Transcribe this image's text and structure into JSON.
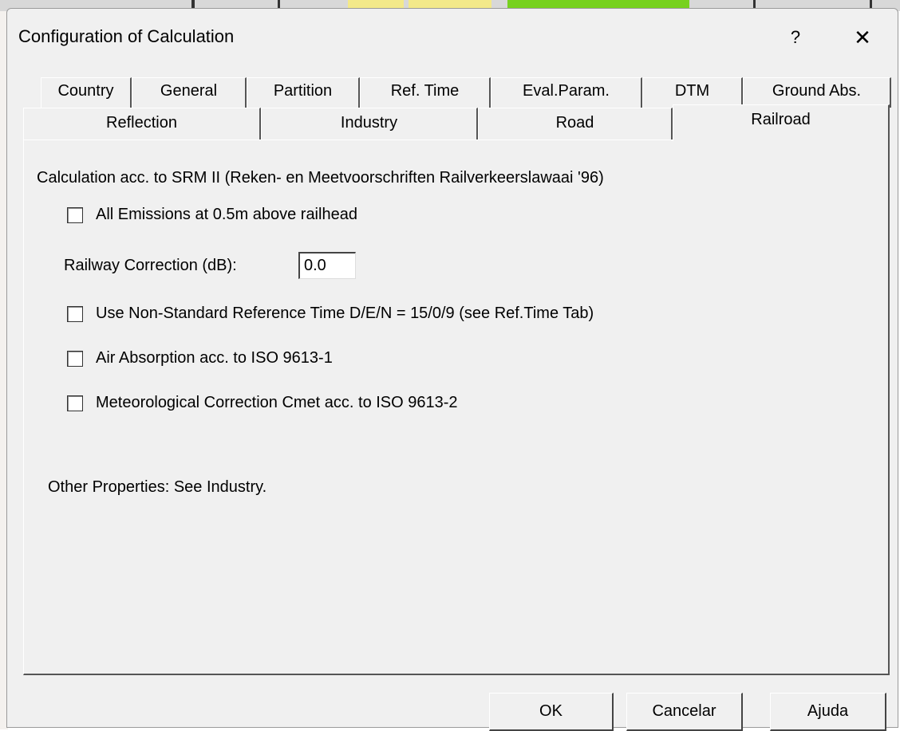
{
  "dialog": {
    "title": "Configuration of Calculation",
    "help_label": "?",
    "close_label": "✕"
  },
  "tabs": {
    "row1": [
      "Country",
      "General",
      "Partition",
      "Ref. Time",
      "Eval.Param.",
      "DTM",
      "Ground Abs."
    ],
    "row2": [
      "Reflection",
      "Industry",
      "Road",
      "Railroad"
    ],
    "active": "Railroad"
  },
  "railroad": {
    "heading": "Calculation acc. to SRM II (Reken- en Meetvoorschriften Railverkeerslawaai '96)",
    "emissions_label": "All Emissions at 0.5m above railhead",
    "emissions_checked": false,
    "correction_label": "Railway Correction (dB):",
    "correction_value": "0.0",
    "nonstandard_label": "Use Non-Standard Reference Time D/E/N = 15/0/9 (see Ref.Time Tab)",
    "nonstandard_checked": false,
    "air_label": "Air Absorption acc. to ISO 9613-1",
    "air_checked": false,
    "meteo_label": "Meteorological Correction Cmet acc. to ISO 9613-2",
    "meteo_checked": false,
    "other_label": "Other Properties: See Industry."
  },
  "buttons": {
    "ok": "OK",
    "cancel": "Cancelar",
    "help": "Ajuda"
  },
  "colors": {
    "dialog_bg": "#f0f0f0"
  }
}
